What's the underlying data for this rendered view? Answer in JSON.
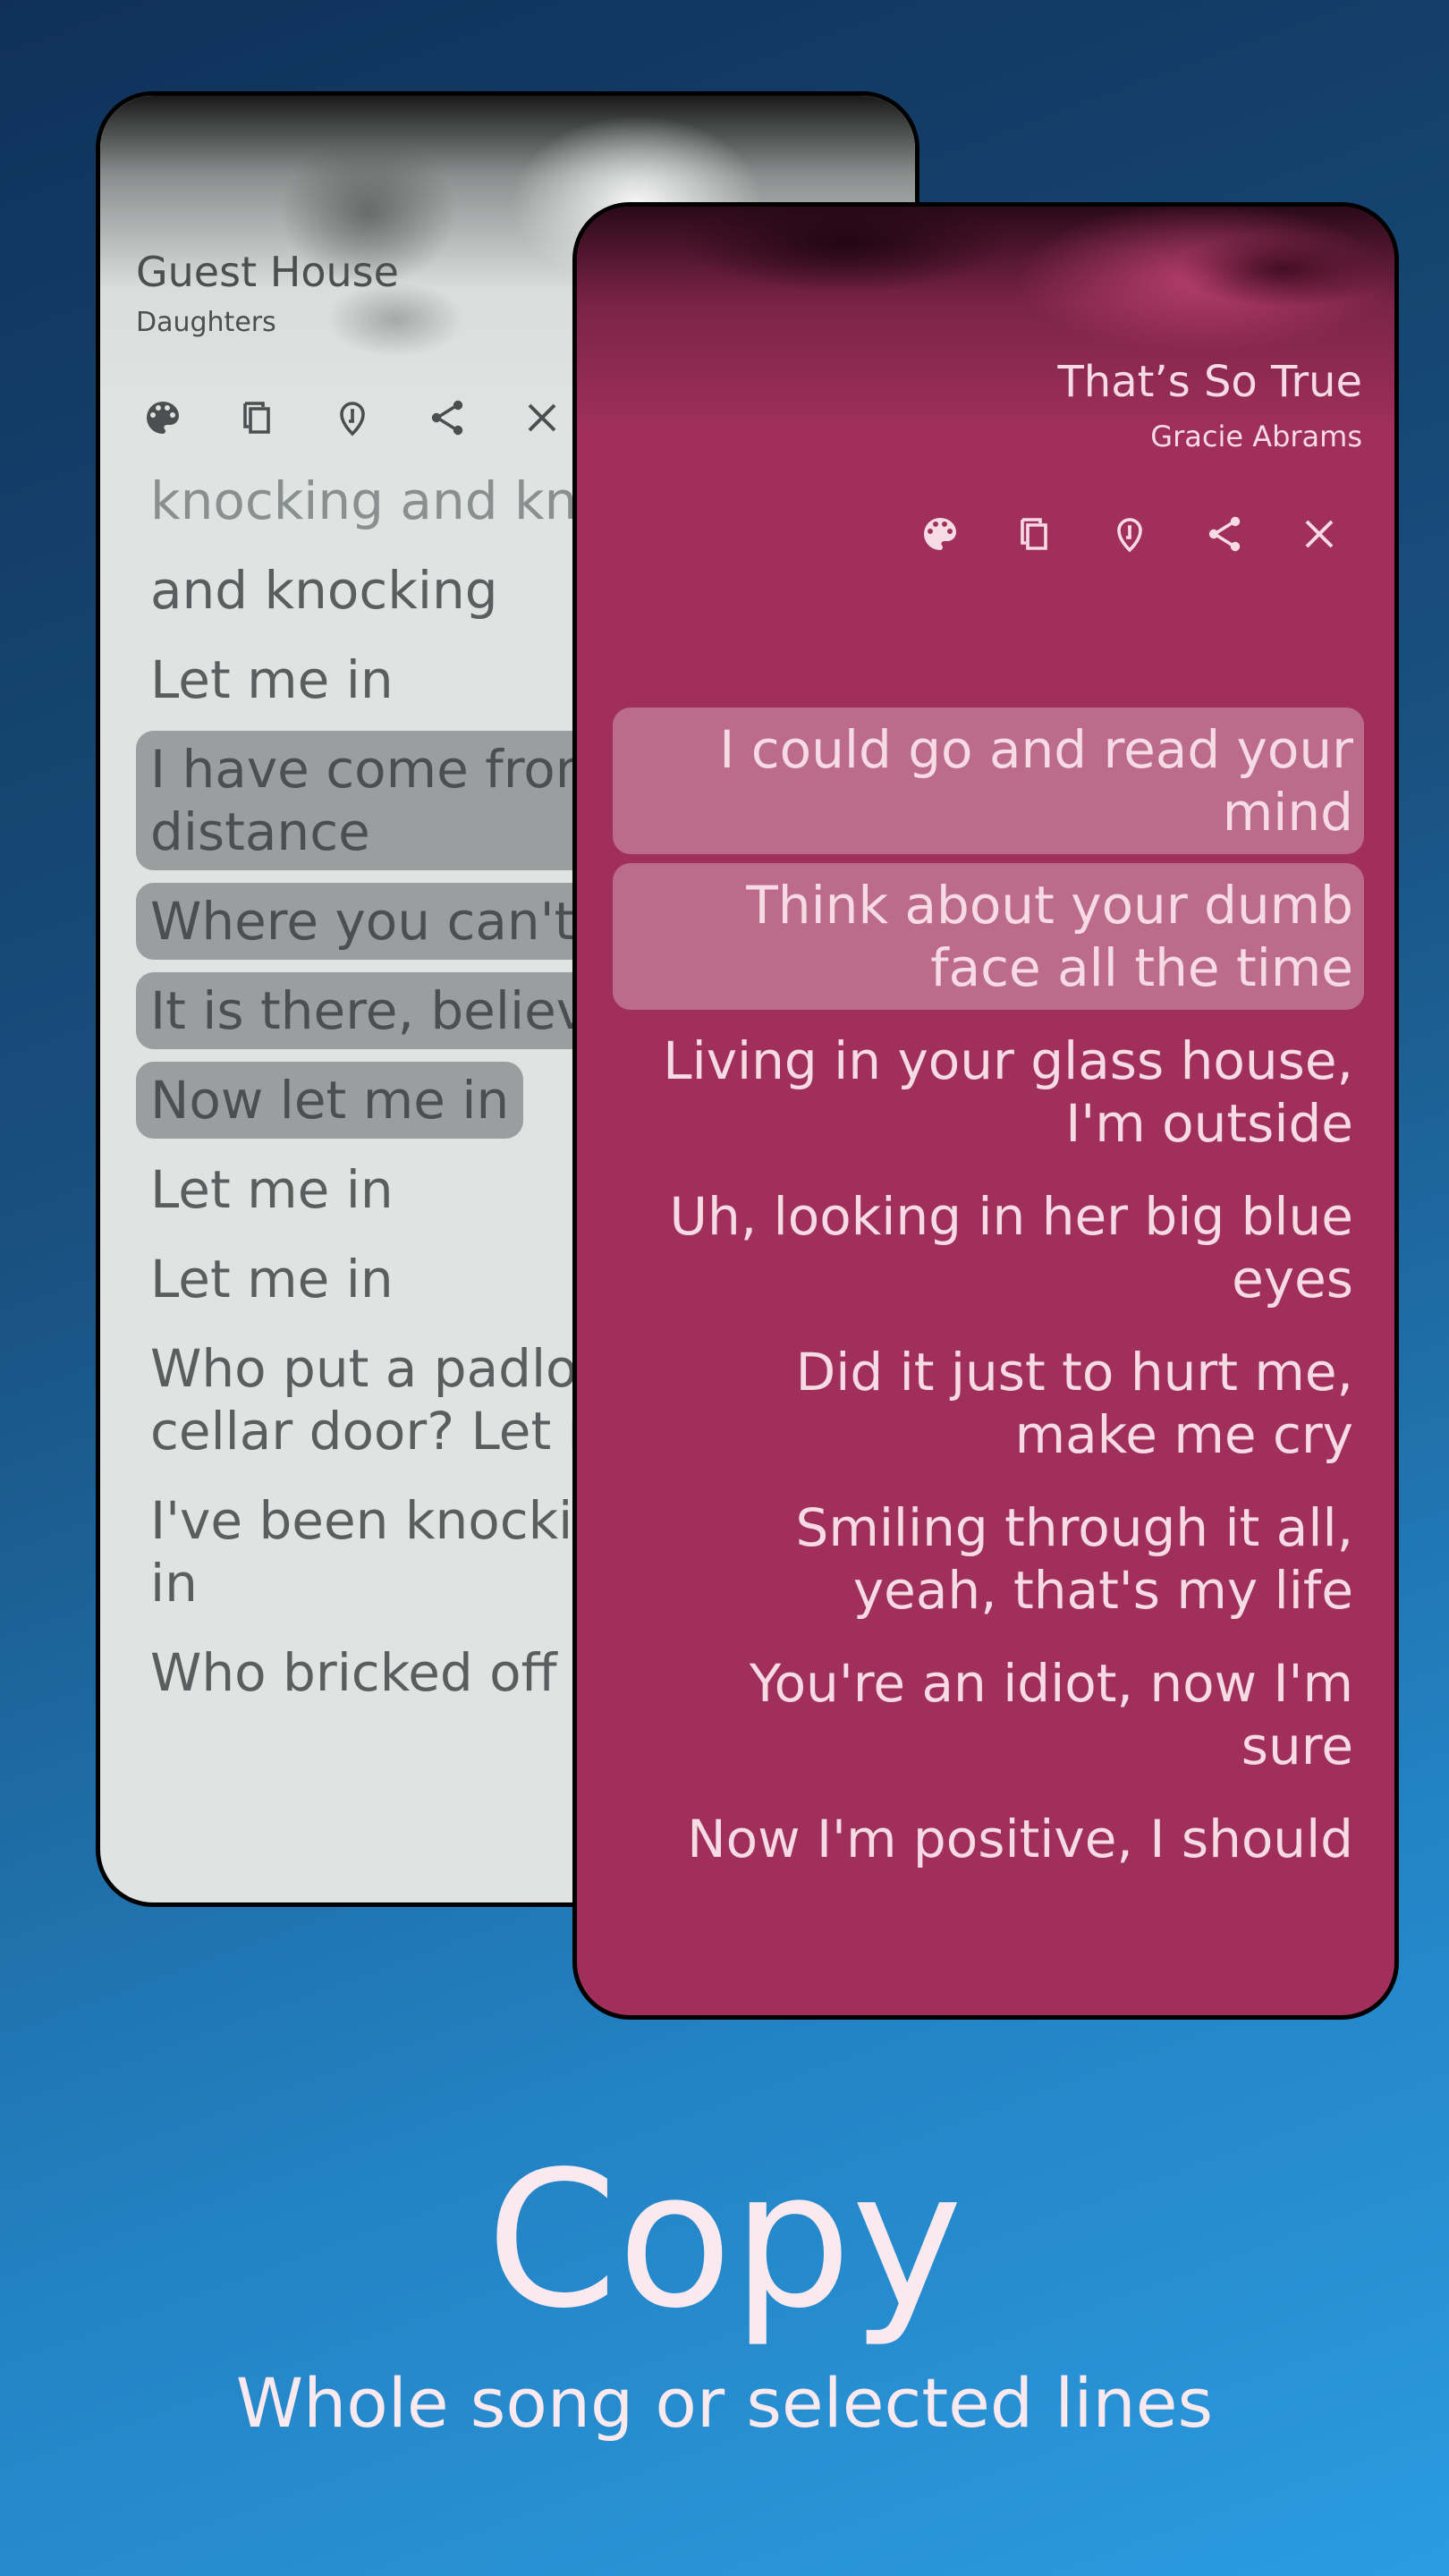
{
  "back_player": {
    "title": "Guest House",
    "artist": "Daughters",
    "icons": [
      "palette-icon",
      "copy-icon",
      "guitar-pick-icon",
      "share-icon",
      "close-icon"
    ],
    "lyrics": [
      {
        "text": "knocking and knocking",
        "selected": false,
        "faded": true
      },
      {
        "text": "and knocking",
        "selected": false
      },
      {
        "text": "Let me in",
        "selected": false
      },
      {
        "text": "I have come from a great\ndistance",
        "selected": true
      },
      {
        "text": "Where you can't see",
        "selected": true
      },
      {
        "text": "It is there, believe me",
        "selected": true
      },
      {
        "text": "Now let me in",
        "selected": true
      },
      {
        "text": "Let me in",
        "selected": false
      },
      {
        "text": "Let me in",
        "selected": false
      },
      {
        "text": "Who put a padlock on the\ncellar door? Let me in",
        "selected": false
      },
      {
        "text": "I've been knocking, let me\nin",
        "selected": false
      },
      {
        "text": "Who bricked off the",
        "selected": false
      }
    ]
  },
  "front_player": {
    "title": "That’s So True",
    "artist": "Gracie Abrams",
    "icons": [
      "palette-icon",
      "copy-icon",
      "guitar-pick-icon",
      "share-icon",
      "close-icon"
    ],
    "lyrics": [
      {
        "text": "I could go and read your\nmind",
        "selected": true
      },
      {
        "text": "Think about your dumb\nface all the time",
        "selected": true
      },
      {
        "text": "Living in your glass house,\nI'm outside",
        "selected": false
      },
      {
        "text": "Uh, looking in her big blue\neyes",
        "selected": false
      },
      {
        "text": "Did it just to hurt me,\nmake me cry",
        "selected": false
      },
      {
        "text": "Smiling through it all,\nyeah, that's my life",
        "selected": false
      },
      {
        "text": "You're an idiot, now I'm\nsure",
        "selected": false
      },
      {
        "text": "Now I'm positive, I should",
        "selected": false
      }
    ]
  },
  "headline": "Copy",
  "subline": "Whole song or selected lines",
  "colors": {
    "back_bg": "#dfe4e3",
    "front_bg": "#a0305b",
    "front_selected": "#bd6b8b",
    "back_selected": "#9a9e9e"
  }
}
